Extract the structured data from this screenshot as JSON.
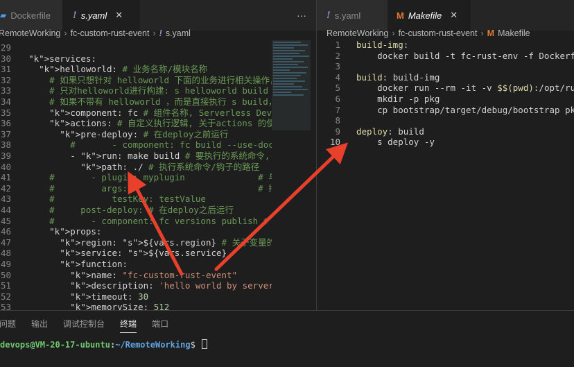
{
  "left_tabs": [
    {
      "label": "Dockerfile",
      "icon": "docker-icon",
      "active": false
    },
    {
      "label": "s.yaml",
      "icon": "yaml-icon",
      "active": true
    }
  ],
  "left_more": "···",
  "right_tabs": [
    {
      "label": "s.yaml",
      "icon": "yaml-icon",
      "active": false
    },
    {
      "label": "Makefile",
      "icon": "makefile-icon",
      "active": true
    }
  ],
  "left_breadcrumb": [
    "RemoteWorking",
    "fc-custom-rust-event",
    "s.yaml"
  ],
  "right_breadcrumb": [
    "RemoteWorking",
    "fc-custom-rust-event",
    "Makefile"
  ],
  "left_code": {
    "line_numbers": [
      "29",
      "30",
      "31",
      "32",
      "33",
      "34",
      "35",
      "36",
      "37",
      "38",
      "39",
      "40",
      "41",
      "42",
      "43",
      "44",
      "45",
      "46",
      "47",
      "48",
      "49",
      "50",
      "51",
      "52",
      "53"
    ],
    "lines": [
      "",
      "  services:",
      "    helloworld: # 业务名称/模块名称",
      "      # 如果只想针对 helloworld 下面的业务进行相关操作，可以在命令",
      "      # 只对helloworld进行构建: s helloworld build",
      "      # 如果不带有 helloworld ，而是直接执行 s build，工具则会对",
      "      component: fc # 组件名称, Serverless Devs 工具本身类似于",
      "      actions: # 自定义执行逻辑, 关于actions 的使用，可以参考: h",
      "        pre-deploy: # 在deploy之前运行",
      "          #       - component: fc build --use-docker # 要",
      "          - run: make build # 要执行的系统命令, 类似于一种钩子的",
      "            path: ./ # 执行系统命令/钩子的路径",
      "      #       - plugin: myplugin              # 与运行的插",
      "      #         args:                         # 插件的参数",
      "      #           testKey: testValue",
      "      #     post-deploy: # 在deploy之后运行",
      "      #       - component: fc versions publish # 要运行的",
      "      props:",
      "        region: ${vars.region} # 关于变量的使用方法, 可以参考:",
      "        service: ${vars.service}",
      "        function:",
      "          name: \"fc-custom-rust-event\"",
      "          description: 'hello world by serverless devs'",
      "          timeout: 30",
      "          memorySize: 512"
    ]
  },
  "right_code": {
    "line_numbers": [
      "1",
      "2",
      "3",
      "4",
      "5",
      "6",
      "7",
      "8",
      "9",
      "10"
    ],
    "lines": [
      "build-img:",
      "\tdocker build -t fc-rust-env -f Dockerfile.buil",
      "",
      "build: build-img",
      "\tdocker run --rm -it -v $$(pwd):/opt/rust-demo",
      "\tmkdir -p pkg",
      "\tcp bootstrap/target/debug/bootstrap pkg/",
      "",
      "deploy: build",
      "\ts deploy -y"
    ]
  },
  "panel_tabs": [
    "问题",
    "输出",
    "调试控制台",
    "终端",
    "端口"
  ],
  "panel_active": "终端",
  "terminal": {
    "user": "devops@VM-20-17-ubuntu",
    "sep": ":",
    "path": "~/RemoteWorking",
    "prompt": "$ "
  },
  "colors": {
    "arrow": "#e8402b",
    "accent_tab_m": "#e37933"
  }
}
